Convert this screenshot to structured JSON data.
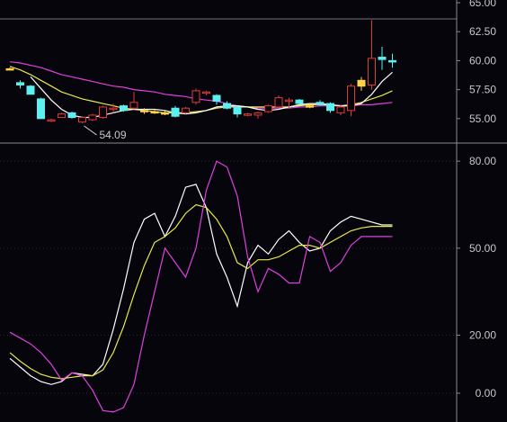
{
  "chart_data": [
    {
      "type": "candlestick",
      "title": "",
      "ylim": [
        53.2,
        65.0
      ],
      "yticks": [
        "55.00",
        "57.50",
        "60.00",
        "62.50",
        "65.00"
      ],
      "min_label": "54.09",
      "reference_level": 63.6,
      "candles": [
        {
          "o": 59.3,
          "h": 59.4,
          "l": 59.2,
          "c": 59.3,
          "color": "#ffd24a"
        },
        {
          "o": 58.1,
          "h": 58.3,
          "l": 57.6,
          "c": 57.9,
          "color": "#5cf0f0"
        },
        {
          "o": 57.8,
          "h": 57.9,
          "l": 57.1,
          "c": 57.1,
          "color": "#5cf0f0"
        },
        {
          "o": 56.7,
          "h": 56.8,
          "l": 55.0,
          "c": 55.0,
          "color": "#5cf0f0"
        },
        {
          "o": 54.9,
          "h": 55.0,
          "l": 54.7,
          "c": 54.9,
          "color": "#e03a3a"
        },
        {
          "o": 55.1,
          "h": 55.5,
          "l": 55.1,
          "c": 55.4,
          "color": "#e03a3a"
        },
        {
          "o": 55.5,
          "h": 55.6,
          "l": 55.0,
          "c": 55.1,
          "color": "#5cf0f0"
        },
        {
          "o": 54.7,
          "h": 55.2,
          "l": 54.6,
          "c": 55.1,
          "color": "#e03a3a"
        },
        {
          "o": 54.9,
          "h": 55.4,
          "l": 54.8,
          "c": 55.3,
          "color": "#e03a3a"
        },
        {
          "o": 55.1,
          "h": 56.1,
          "l": 55.0,
          "c": 56.0,
          "color": "#e03a3a"
        },
        {
          "o": 55.9,
          "h": 56.3,
          "l": 55.5,
          "c": 55.9,
          "color": "#e03a3a"
        },
        {
          "o": 56.1,
          "h": 56.2,
          "l": 55.6,
          "c": 55.7,
          "color": "#5cf0f0"
        },
        {
          "o": 55.9,
          "h": 57.3,
          "l": 55.8,
          "c": 56.4,
          "color": "#e03a3a"
        },
        {
          "o": 55.7,
          "h": 55.9,
          "l": 55.4,
          "c": 55.6,
          "color": "#ffd24a"
        },
        {
          "o": 55.6,
          "h": 55.8,
          "l": 55.4,
          "c": 55.6,
          "color": "#ffd24a"
        },
        {
          "o": 55.5,
          "h": 55.7,
          "l": 55.3,
          "c": 55.5,
          "color": "#ffd24a"
        },
        {
          "o": 55.9,
          "h": 56.1,
          "l": 55.1,
          "c": 55.2,
          "color": "#5cf0f0"
        },
        {
          "o": 55.5,
          "h": 56.0,
          "l": 55.4,
          "c": 55.9,
          "color": "#e03a3a"
        },
        {
          "o": 56.4,
          "h": 57.6,
          "l": 56.2,
          "c": 57.4,
          "color": "#e03a3a"
        },
        {
          "o": 57.2,
          "h": 57.4,
          "l": 57.0,
          "c": 57.3,
          "color": "#e03a3a"
        },
        {
          "o": 57.0,
          "h": 57.1,
          "l": 56.2,
          "c": 56.5,
          "color": "#5cf0f0"
        },
        {
          "o": 56.3,
          "h": 56.5,
          "l": 55.8,
          "c": 55.9,
          "color": "#5cf0f0"
        },
        {
          "o": 56.0,
          "h": 56.1,
          "l": 55.1,
          "c": 55.4,
          "color": "#5cf0f0"
        },
        {
          "o": 55.4,
          "h": 55.5,
          "l": 55.2,
          "c": 55.3,
          "color": "#e03a3a"
        },
        {
          "o": 55.3,
          "h": 55.6,
          "l": 55.0,
          "c": 55.5,
          "color": "#e03a3a"
        },
        {
          "o": 55.6,
          "h": 56.2,
          "l": 55.5,
          "c": 56.1,
          "color": "#e03a3a"
        },
        {
          "o": 56.0,
          "h": 57.0,
          "l": 55.9,
          "c": 56.8,
          "color": "#e03a3a"
        },
        {
          "o": 56.6,
          "h": 56.8,
          "l": 55.9,
          "c": 56.5,
          "color": "#e03a3a"
        },
        {
          "o": 56.6,
          "h": 56.7,
          "l": 56.2,
          "c": 56.3,
          "color": "#5cf0f0"
        },
        {
          "o": 56.1,
          "h": 56.3,
          "l": 55.9,
          "c": 56.1,
          "color": "#ffd24a"
        },
        {
          "o": 56.4,
          "h": 56.6,
          "l": 56.1,
          "c": 56.2,
          "color": "#5cf0f0"
        },
        {
          "o": 56.3,
          "h": 56.4,
          "l": 55.5,
          "c": 55.7,
          "color": "#5cf0f0"
        },
        {
          "o": 55.5,
          "h": 56.2,
          "l": 55.3,
          "c": 56.0,
          "color": "#e03a3a"
        },
        {
          "o": 55.7,
          "h": 58.0,
          "l": 55.2,
          "c": 57.8,
          "color": "#e03a3a"
        },
        {
          "o": 57.8,
          "h": 58.6,
          "l": 57.4,
          "c": 58.3,
          "color": "#ffd24a"
        },
        {
          "o": 57.9,
          "h": 63.5,
          "l": 57.5,
          "c": 60.2,
          "color": "#e03a3a"
        },
        {
          "o": 60.3,
          "h": 61.2,
          "l": 59.2,
          "c": 60.1,
          "color": "#5cf0f0"
        },
        {
          "o": 60.0,
          "h": 60.6,
          "l": 59.4,
          "c": 60.0,
          "color": "#5cf0f0"
        }
      ],
      "ma_lines": [
        {
          "color": "#e040e0",
          "values": [
            59.9,
            59.8,
            59.6,
            59.4,
            59.1,
            58.8,
            58.6,
            58.4,
            58.2,
            58.0,
            57.8,
            57.7,
            57.5,
            57.4,
            57.3,
            57.1,
            57.0,
            56.9,
            56.7,
            56.6,
            56.5,
            56.3,
            56.1,
            56.0,
            55.9,
            55.9,
            55.9,
            55.9,
            56.0,
            56.0,
            56.1,
            56.1,
            56.1,
            56.1,
            56.2,
            56.2,
            56.3,
            56.4
          ]
        },
        {
          "color": "#e8e84a",
          "values": [
            59.5,
            59.2,
            58.8,
            58.3,
            57.8,
            57.3,
            57.0,
            56.7,
            56.5,
            56.3,
            56.1,
            55.9,
            55.8,
            55.7,
            55.6,
            55.5,
            55.5,
            55.5,
            55.6,
            55.7,
            55.9,
            56.0,
            56.0,
            56.0,
            56.0,
            56.0,
            56.0,
            56.0,
            56.1,
            56.2,
            56.2,
            56.2,
            56.1,
            56.2,
            56.4,
            56.7,
            57.0,
            57.4
          ]
        },
        {
          "color": "#ffffff",
          "values": [
            null,
            null,
            58.6,
            57.6,
            56.6,
            55.8,
            55.3,
            55.1,
            55.1,
            55.3,
            55.5,
            55.7,
            55.8,
            55.8,
            55.8,
            55.7,
            55.5,
            55.4,
            55.5,
            55.7,
            56.0,
            56.1,
            56.1,
            56.0,
            55.8,
            55.7,
            55.8,
            56.0,
            56.2,
            56.3,
            56.3,
            56.2,
            56.1,
            56.1,
            56.3,
            57.1,
            58.2,
            59.0
          ]
        }
      ]
    },
    {
      "type": "line",
      "title": "",
      "ylim": [
        -9,
        85
      ],
      "yticks": [
        "0.00",
        "20.00",
        "50.00",
        "80.00"
      ],
      "x": [
        0,
        1,
        2,
        3,
        4,
        5,
        6,
        7,
        8,
        9,
        10,
        11,
        12,
        13,
        14,
        15,
        16,
        17,
        18,
        19,
        20,
        21,
        22,
        23,
        24,
        25,
        26,
        27,
        28,
        29,
        30,
        31,
        32,
        33,
        34,
        35,
        36,
        37
      ],
      "series": [
        {
          "color": "#ffffff",
          "values": [
            12.0,
            9.0,
            6.0,
            4.0,
            3.0,
            4.0,
            7.0,
            6.5,
            6.0,
            10.0,
            22.0,
            36.0,
            52.0,
            60.0,
            62.0,
            54.0,
            61.0,
            71.0,
            72.0,
            64.0,
            48.0,
            40.0,
            30.0,
            45.0,
            51.0,
            48.0,
            53.0,
            56.0,
            52.0,
            49.0,
            50.0,
            56.0,
            59.0,
            61.0,
            60.0,
            59.0,
            58.0,
            58.0
          ]
        },
        {
          "color": "#e8e84a",
          "values": [
            14.0,
            11.0,
            8.5,
            6.5,
            5.5,
            5.0,
            5.5,
            6.0,
            6.0,
            8.0,
            14.0,
            23.0,
            34.0,
            44.0,
            52.0,
            54.0,
            57.0,
            62.0,
            65.0,
            64.0,
            60.0,
            54.0,
            45.0,
            43.0,
            46.0,
            46.0,
            47.0,
            49.0,
            51.0,
            51.0,
            50.0,
            52.0,
            54.0,
            56.0,
            57.0,
            57.5,
            57.5,
            57.5
          ]
        },
        {
          "color": "#e040e0",
          "values": [
            21.0,
            19.0,
            17.0,
            14.0,
            10.0,
            4.5,
            7.0,
            6.0,
            1.0,
            -6.0,
            -6.5,
            -5.0,
            3.0,
            20.0,
            35.0,
            50.0,
            45.0,
            40.0,
            50.0,
            70.0,
            80.0,
            78.0,
            68.0,
            47.0,
            35.0,
            43.0,
            41.0,
            38.0,
            38.0,
            54.0,
            52.0,
            42.0,
            45.0,
            51.0,
            54.0,
            54.0,
            54.0,
            54.0
          ]
        }
      ]
    }
  ]
}
